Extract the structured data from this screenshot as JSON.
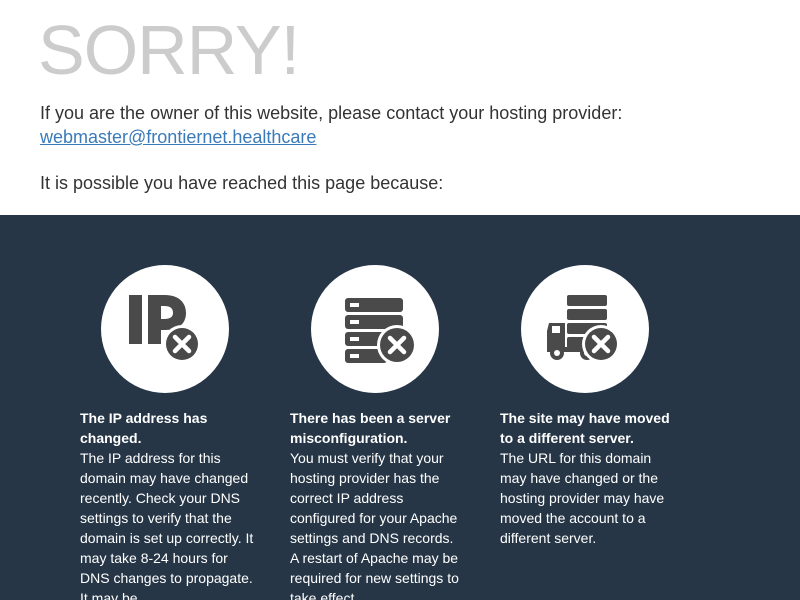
{
  "header": {
    "title": "SORRY!",
    "owner_text": "If you are the owner of this website, please contact your hosting provider:",
    "contact_email": "webmaster@frontiernet.healthcare",
    "reason_intro": "It is possible you have reached this page because:"
  },
  "reasons": [
    {
      "icon": "ip-error-icon",
      "heading": "The IP address has changed.",
      "body": "The IP address for this domain may have changed recently. Check your DNS settings to verify that the domain is set up correctly. It may take 8-24 hours for DNS changes to propagate. It may be"
    },
    {
      "icon": "server-error-icon",
      "heading": "There has been a server misconfiguration.",
      "body": "You must verify that your hosting provider has the correct IP address configured for your Apache settings and DNS records. A restart of Apache may be required for new settings to take effect."
    },
    {
      "icon": "server-moved-icon",
      "heading": "The site may have moved to a different server.",
      "body": "The URL for this domain may have changed or the hosting provider may have moved the account to a different server."
    }
  ],
  "colors": {
    "title": "#cccccc",
    "link": "#3a7ab8",
    "panel_background": "#263646",
    "icon": "#4a4a4a"
  }
}
